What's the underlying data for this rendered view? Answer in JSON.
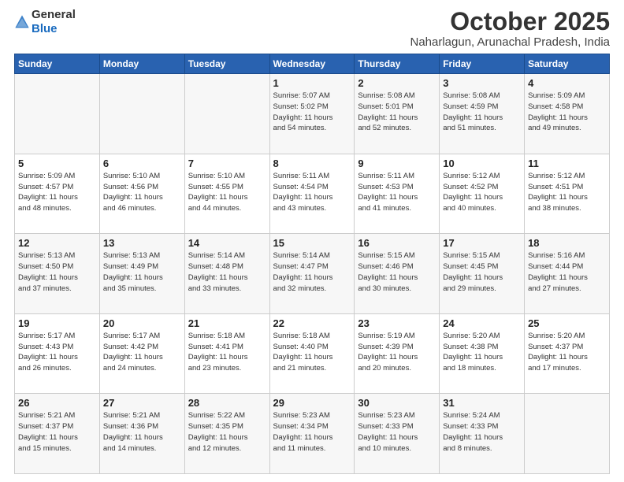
{
  "header": {
    "logo_general": "General",
    "logo_blue": "Blue",
    "month": "October 2025",
    "location": "Naharlagun, Arunachal Pradesh, India"
  },
  "weekdays": [
    "Sunday",
    "Monday",
    "Tuesday",
    "Wednesday",
    "Thursday",
    "Friday",
    "Saturday"
  ],
  "weeks": [
    [
      {
        "day": "",
        "info": ""
      },
      {
        "day": "",
        "info": ""
      },
      {
        "day": "",
        "info": ""
      },
      {
        "day": "1",
        "info": "Sunrise: 5:07 AM\nSunset: 5:02 PM\nDaylight: 11 hours\nand 54 minutes."
      },
      {
        "day": "2",
        "info": "Sunrise: 5:08 AM\nSunset: 5:01 PM\nDaylight: 11 hours\nand 52 minutes."
      },
      {
        "day": "3",
        "info": "Sunrise: 5:08 AM\nSunset: 4:59 PM\nDaylight: 11 hours\nand 51 minutes."
      },
      {
        "day": "4",
        "info": "Sunrise: 5:09 AM\nSunset: 4:58 PM\nDaylight: 11 hours\nand 49 minutes."
      }
    ],
    [
      {
        "day": "5",
        "info": "Sunrise: 5:09 AM\nSunset: 4:57 PM\nDaylight: 11 hours\nand 48 minutes."
      },
      {
        "day": "6",
        "info": "Sunrise: 5:10 AM\nSunset: 4:56 PM\nDaylight: 11 hours\nand 46 minutes."
      },
      {
        "day": "7",
        "info": "Sunrise: 5:10 AM\nSunset: 4:55 PM\nDaylight: 11 hours\nand 44 minutes."
      },
      {
        "day": "8",
        "info": "Sunrise: 5:11 AM\nSunset: 4:54 PM\nDaylight: 11 hours\nand 43 minutes."
      },
      {
        "day": "9",
        "info": "Sunrise: 5:11 AM\nSunset: 4:53 PM\nDaylight: 11 hours\nand 41 minutes."
      },
      {
        "day": "10",
        "info": "Sunrise: 5:12 AM\nSunset: 4:52 PM\nDaylight: 11 hours\nand 40 minutes."
      },
      {
        "day": "11",
        "info": "Sunrise: 5:12 AM\nSunset: 4:51 PM\nDaylight: 11 hours\nand 38 minutes."
      }
    ],
    [
      {
        "day": "12",
        "info": "Sunrise: 5:13 AM\nSunset: 4:50 PM\nDaylight: 11 hours\nand 37 minutes."
      },
      {
        "day": "13",
        "info": "Sunrise: 5:13 AM\nSunset: 4:49 PM\nDaylight: 11 hours\nand 35 minutes."
      },
      {
        "day": "14",
        "info": "Sunrise: 5:14 AM\nSunset: 4:48 PM\nDaylight: 11 hours\nand 33 minutes."
      },
      {
        "day": "15",
        "info": "Sunrise: 5:14 AM\nSunset: 4:47 PM\nDaylight: 11 hours\nand 32 minutes."
      },
      {
        "day": "16",
        "info": "Sunrise: 5:15 AM\nSunset: 4:46 PM\nDaylight: 11 hours\nand 30 minutes."
      },
      {
        "day": "17",
        "info": "Sunrise: 5:15 AM\nSunset: 4:45 PM\nDaylight: 11 hours\nand 29 minutes."
      },
      {
        "day": "18",
        "info": "Sunrise: 5:16 AM\nSunset: 4:44 PM\nDaylight: 11 hours\nand 27 minutes."
      }
    ],
    [
      {
        "day": "19",
        "info": "Sunrise: 5:17 AM\nSunset: 4:43 PM\nDaylight: 11 hours\nand 26 minutes."
      },
      {
        "day": "20",
        "info": "Sunrise: 5:17 AM\nSunset: 4:42 PM\nDaylight: 11 hours\nand 24 minutes."
      },
      {
        "day": "21",
        "info": "Sunrise: 5:18 AM\nSunset: 4:41 PM\nDaylight: 11 hours\nand 23 minutes."
      },
      {
        "day": "22",
        "info": "Sunrise: 5:18 AM\nSunset: 4:40 PM\nDaylight: 11 hours\nand 21 minutes."
      },
      {
        "day": "23",
        "info": "Sunrise: 5:19 AM\nSunset: 4:39 PM\nDaylight: 11 hours\nand 20 minutes."
      },
      {
        "day": "24",
        "info": "Sunrise: 5:20 AM\nSunset: 4:38 PM\nDaylight: 11 hours\nand 18 minutes."
      },
      {
        "day": "25",
        "info": "Sunrise: 5:20 AM\nSunset: 4:37 PM\nDaylight: 11 hours\nand 17 minutes."
      }
    ],
    [
      {
        "day": "26",
        "info": "Sunrise: 5:21 AM\nSunset: 4:37 PM\nDaylight: 11 hours\nand 15 minutes."
      },
      {
        "day": "27",
        "info": "Sunrise: 5:21 AM\nSunset: 4:36 PM\nDaylight: 11 hours\nand 14 minutes."
      },
      {
        "day": "28",
        "info": "Sunrise: 5:22 AM\nSunset: 4:35 PM\nDaylight: 11 hours\nand 12 minutes."
      },
      {
        "day": "29",
        "info": "Sunrise: 5:23 AM\nSunset: 4:34 PM\nDaylight: 11 hours\nand 11 minutes."
      },
      {
        "day": "30",
        "info": "Sunrise: 5:23 AM\nSunset: 4:33 PM\nDaylight: 11 hours\nand 10 minutes."
      },
      {
        "day": "31",
        "info": "Sunrise: 5:24 AM\nSunset: 4:33 PM\nDaylight: 11 hours\nand 8 minutes."
      },
      {
        "day": "",
        "info": ""
      }
    ]
  ]
}
